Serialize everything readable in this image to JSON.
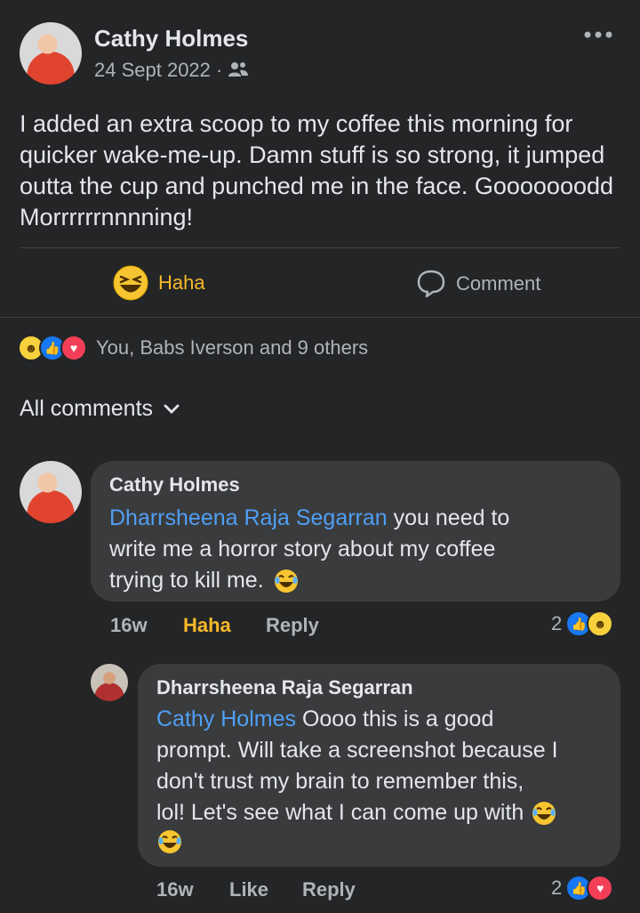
{
  "post": {
    "author": "Cathy Holmes",
    "date": "24 Sept 2022 ·",
    "more_icon": "more-dots-icon",
    "audience_icon": "friends-icon",
    "body": "I added an extra scoop to my coffee this morning for quicker wake-me-up. Damn stuff is so strong, it jumped outta the cup and punched me in the face. Gooooooodd Morrrrrrnnnning!"
  },
  "actions": {
    "haha_label": "Haha",
    "comment_label": "Comment"
  },
  "reactions_summary": "You, Babs Iverson and 9 others",
  "comments_header": "All comments",
  "comments": [
    {
      "author": "Cathy Holmes",
      "mention": "Dharrsheena Raja Segarran",
      "text_line1": " you need to",
      "text_line2": "write me a horror story about my coffee",
      "text_line3": "trying to kill me.",
      "time": "16w",
      "reaction_label": "Haha",
      "reply_label": "Reply",
      "reaction_count": "2"
    },
    {
      "author": "Dharrsheena Raja Segarran",
      "mention": "Cathy Holmes",
      "text_line1": " Oooo this is a good",
      "text_line2": "prompt. Will take a screenshot because I",
      "text_line3": "don't trust my brain to remember this,",
      "text_line4": "lol! Let's see what I can come up with",
      "time": "16w",
      "reaction_label": "Like",
      "reply_label": "Reply",
      "reaction_count": "2"
    }
  ],
  "colors": {
    "background": "#242526",
    "bubble": "#3a3b3c",
    "mention": "#4f9ff5",
    "haha_active": "#f7b928"
  }
}
